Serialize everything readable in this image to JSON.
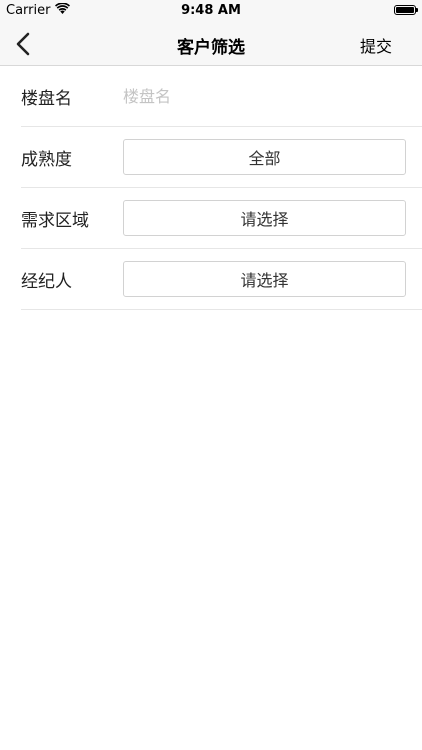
{
  "status_bar": {
    "carrier": "Carrier",
    "time": "9:48 AM",
    "battery_level": 1.0
  },
  "nav": {
    "title": "客户筛选",
    "submit_label": "提交"
  },
  "form": {
    "building": {
      "label": "楼盘名",
      "value": "",
      "placeholder": "楼盘名"
    },
    "maturity": {
      "label": "成熟度",
      "value": "全部"
    },
    "area": {
      "label": "需求区域",
      "value": "请选择"
    },
    "agent": {
      "label": "经纪人",
      "value": "请选择"
    }
  }
}
